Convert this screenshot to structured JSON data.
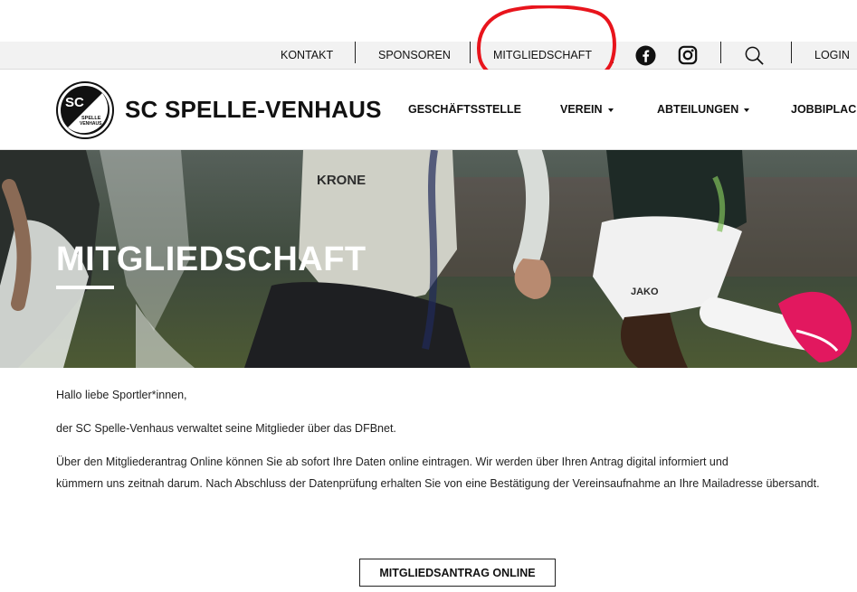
{
  "topbar": {
    "links": [
      "KONTAKT",
      "SPONSOREN",
      "MITGLIEDSCHAFT"
    ],
    "login": "LOGIN"
  },
  "header": {
    "logo_letters": "SC",
    "logo_small_line1": "SPELLE",
    "logo_small_line2": "VENHAUS",
    "brand": "SC SPELLE-VENHAUS",
    "nav": [
      "GESCHÄFTSSTELLE",
      "VEREIN",
      "ABTEILUNGEN",
      "JOBBIPLACE"
    ]
  },
  "hero": {
    "title": "MITGLIEDSCHAFT",
    "shirt_text_1": "KRONE",
    "shirt_text_2": "JAKO"
  },
  "content": {
    "greeting": "Hallo liebe Sportler*innen,",
    "line1": "der SC Spelle-Venhaus verwaltet seine Mitglieder über das DFBnet.",
    "line2a": "Über den Mitgliederantrag Online können Sie ab sofort Ihre Daten online eintragen. Wir werden über Ihren Antrag digital informiert und",
    "line2b": "kümmern uns zeitnah darum. Nach Abschluss der Datenprüfung erhalten Sie von eine Bestätigung der Vereinsaufnahme an Ihre Mailadresse übersandt.",
    "cta": "MITGLIEDSANTRAG ONLINE"
  },
  "colors": {
    "annotation": "#e8141c",
    "topbar_bg": "#f2f2f2",
    "boot_pink": "#e2185f"
  },
  "icons": [
    "facebook-icon",
    "instagram-icon",
    "search-icon",
    "caret-down-icon"
  ]
}
